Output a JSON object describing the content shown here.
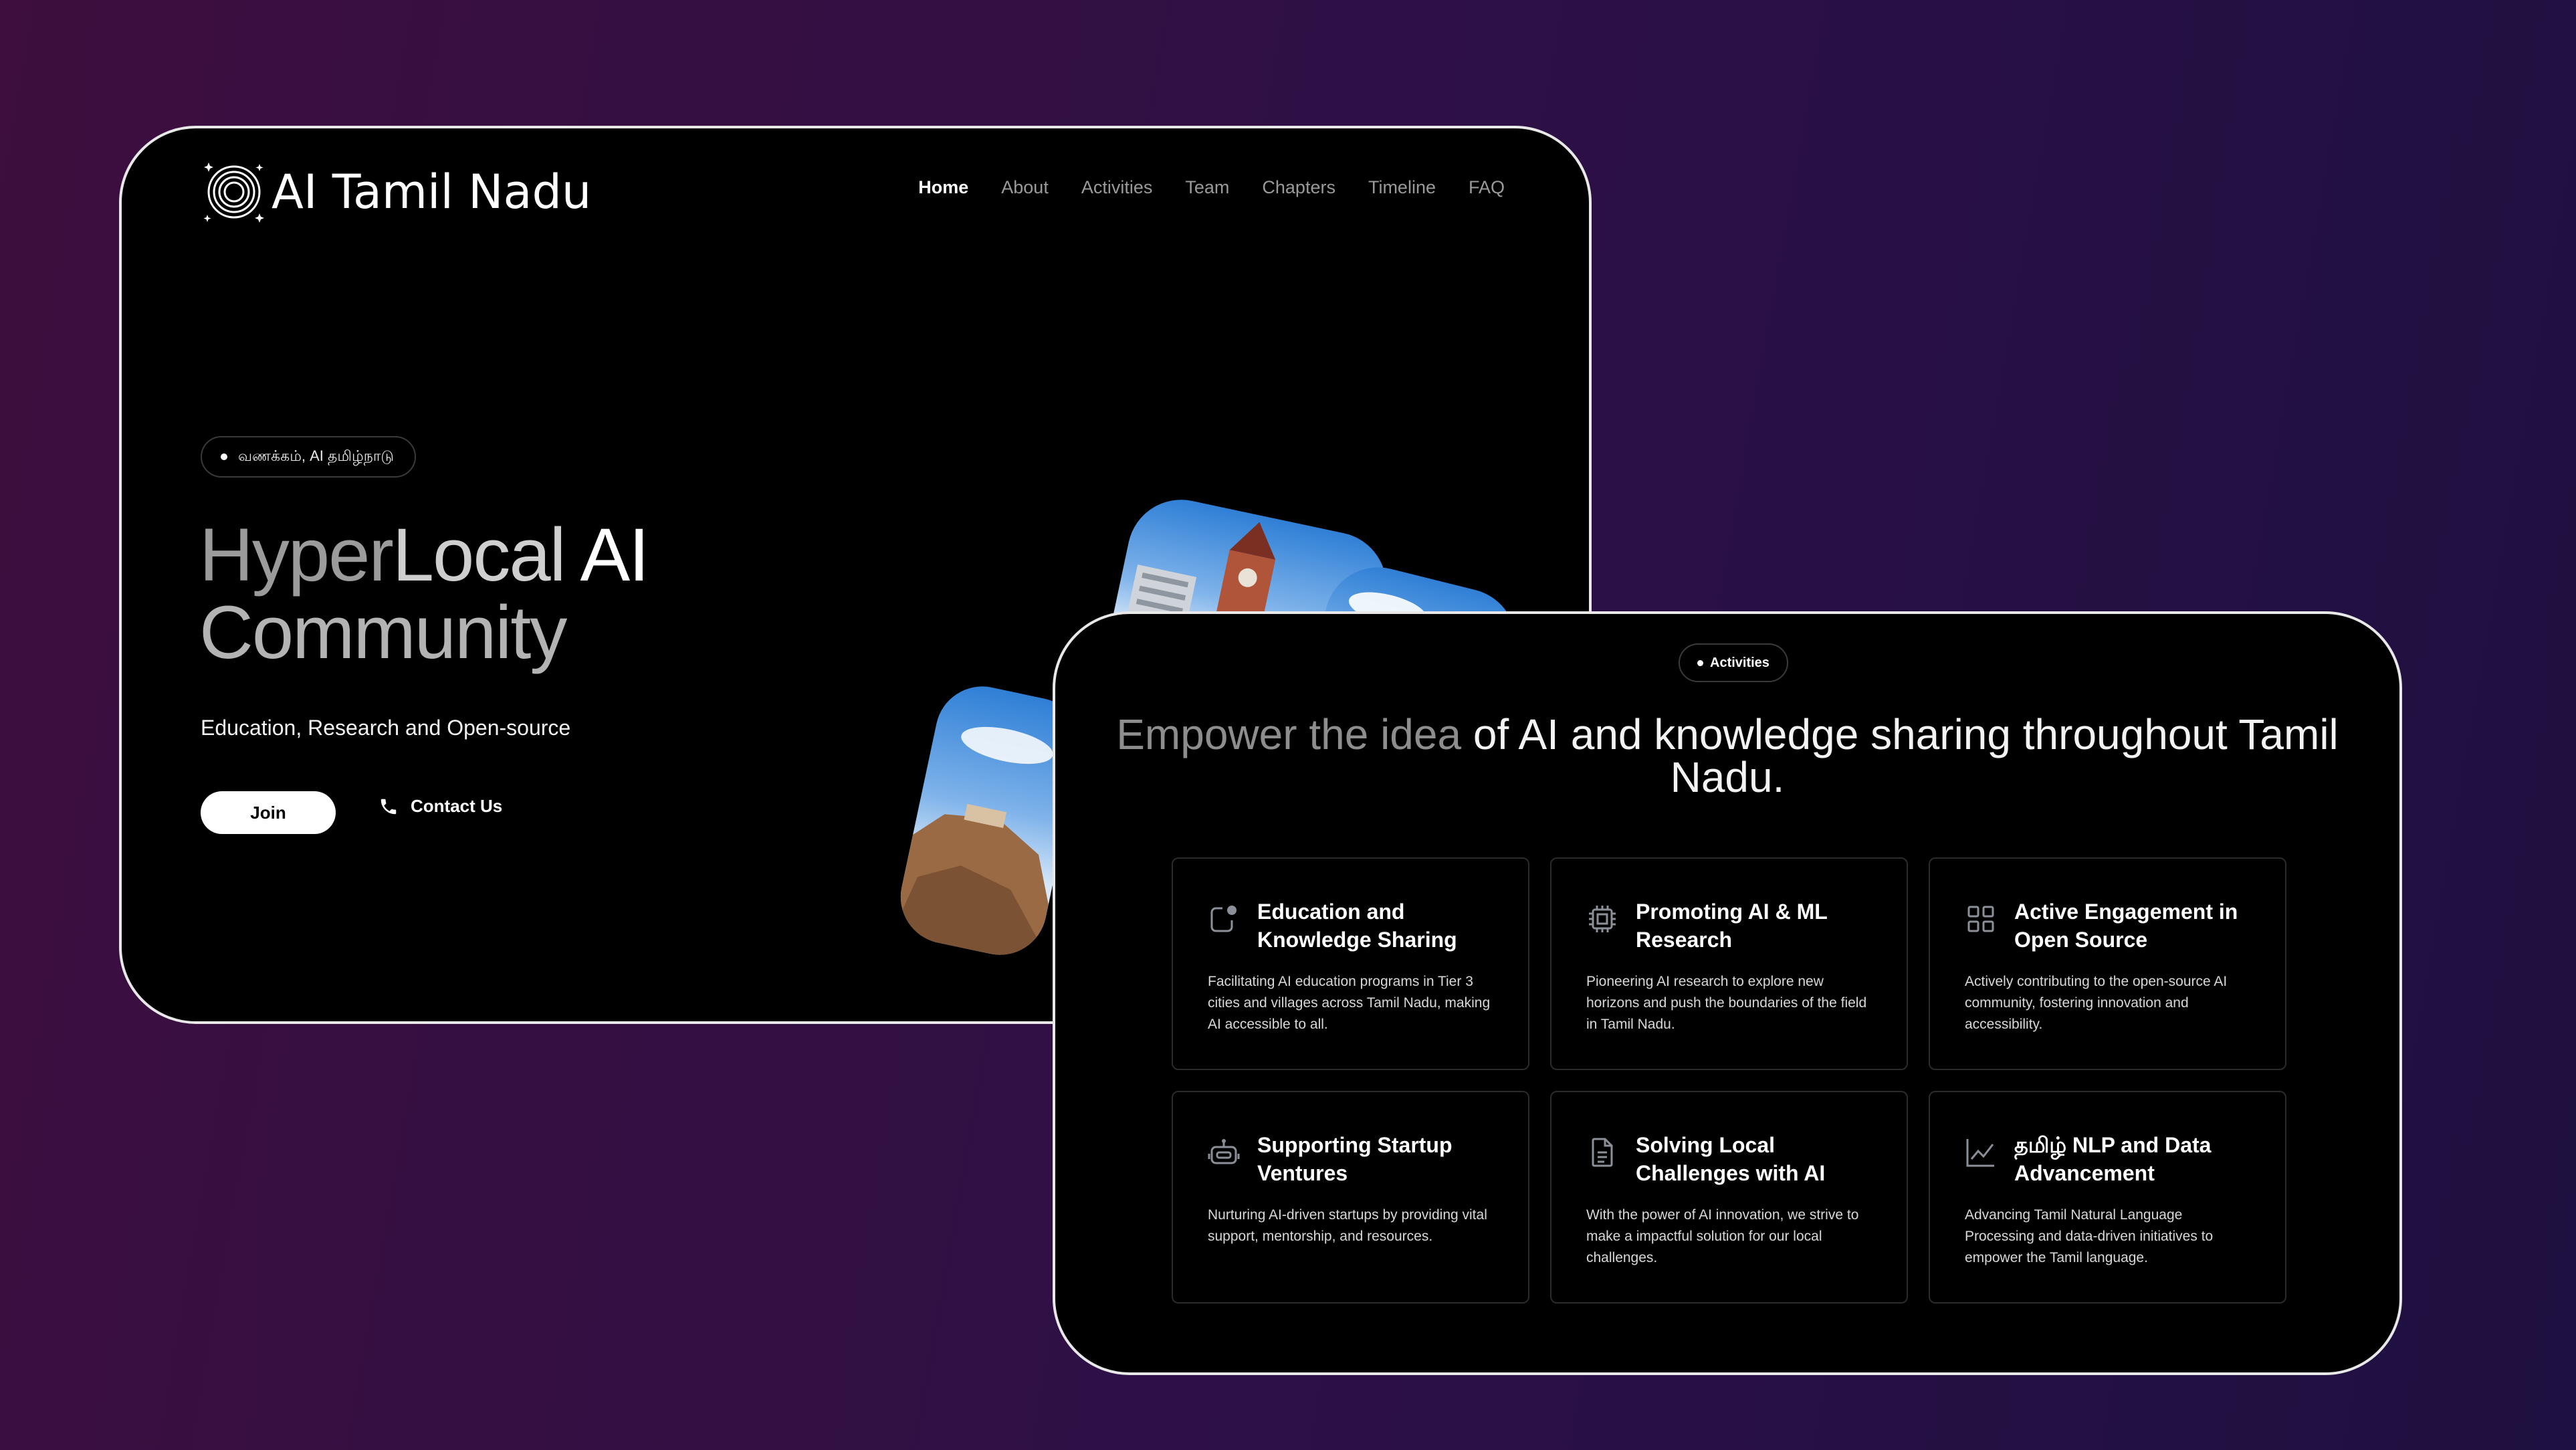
{
  "brand": {
    "name": "AI Tamil Nadu"
  },
  "nav": {
    "items": [
      "Home",
      "About",
      "Activities",
      "Team",
      "Chapters",
      "Timeline",
      "FAQ"
    ],
    "active": "Home"
  },
  "hero": {
    "badge": "வணக்கம், AI தமிழ்நாடு",
    "title_part1": "Hyper",
    "title_part2": "Local",
    "title_part3": " AI",
    "title_line2": "Community",
    "subtitle": "Education, Research and Open-source",
    "join_label": "Join",
    "contact_label": "Contact Us"
  },
  "activities": {
    "badge": "Activities",
    "title_grey": "Empower the idea ",
    "title_white": "of AI and knowledge sharing throughout Tamil Nadu.",
    "cards": [
      {
        "icon": "notification-dot-icon",
        "title": "Education and Knowledge Sharing",
        "desc": "Facilitating AI education programs in Tier 3 cities and villages across Tamil Nadu, making AI accessible to all."
      },
      {
        "icon": "cpu-chip-icon",
        "title": "Promoting AI & ML Research",
        "desc": "Pioneering AI research to explore new horizons and push the boundaries of the field in Tamil Nadu."
      },
      {
        "icon": "grid-icon",
        "title": "Active Engagement in Open Source",
        "desc": "Actively contributing to the open-source AI community, fostering innovation and accessibility."
      },
      {
        "icon": "robot-icon",
        "title": "Supporting Startup Ventures",
        "desc": "Nurturing AI-driven startups by providing vital support, mentorship, and resources."
      },
      {
        "icon": "document-icon",
        "title": "Solving Local Challenges with AI",
        "desc": "With the power of AI innovation, we strive to make a impactful solution for our local challenges."
      },
      {
        "icon": "line-chart-icon",
        "title": "தமிழ் NLP and Data Advancement",
        "desc": "Advancing Tamil Natural Language Processing and data-driven initiatives to empower the Tamil language."
      }
    ]
  },
  "colors": {
    "background_start": "#3d0e3e",
    "background_end": "#1e1040",
    "card_bg": "#000000",
    "card_border": "#e8e8e8"
  }
}
